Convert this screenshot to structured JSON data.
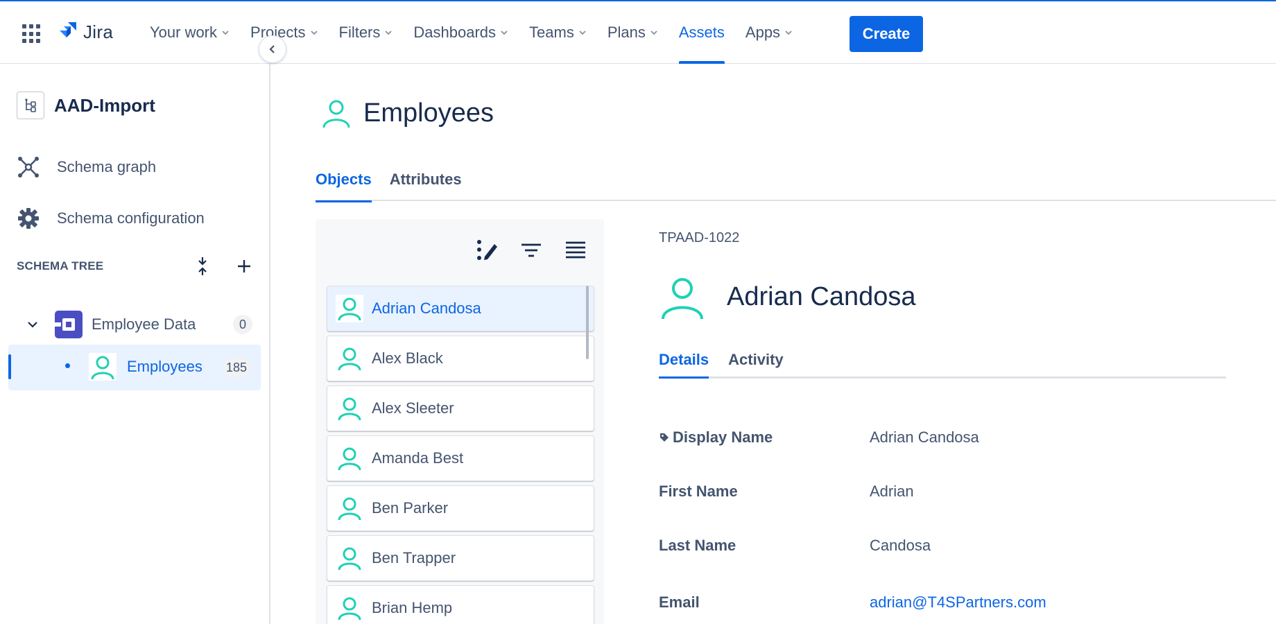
{
  "topnav": {
    "logo_text": "Jira",
    "items": [
      {
        "label": "Your work",
        "dropdown": true
      },
      {
        "label": "Projects",
        "dropdown": true
      },
      {
        "label": "Filters",
        "dropdown": true
      },
      {
        "label": "Dashboards",
        "dropdown": true
      },
      {
        "label": "Teams",
        "dropdown": true
      },
      {
        "label": "Plans",
        "dropdown": true
      },
      {
        "label": "Assets",
        "dropdown": false,
        "active": true
      },
      {
        "label": "Apps",
        "dropdown": true
      }
    ],
    "create_label": "Create"
  },
  "sidebar": {
    "schema_title": "AAD-Import",
    "links": [
      {
        "label": "Schema graph",
        "icon": "schema-graph-icon"
      },
      {
        "label": "Schema configuration",
        "icon": "gear-icon"
      }
    ],
    "tree_heading": "SCHEMA TREE",
    "tree": {
      "parent": {
        "label": "Employee Data",
        "count": "0"
      },
      "child": {
        "label": "Employees",
        "count": "185"
      }
    }
  },
  "main": {
    "title": "Employees",
    "tabs": [
      "Objects",
      "Attributes"
    ],
    "active_tab": "Objects",
    "objects": [
      "Adrian Candosa",
      "Alex Black",
      "Alex Sleeter",
      "Amanda Best",
      "Ben Parker",
      "Ben Trapper",
      "Brian Hemp"
    ],
    "selected_object": "Adrian Candosa"
  },
  "detail": {
    "key": "TPAAD-1022",
    "name": "Adrian Candosa",
    "tabs": [
      "Details",
      "Activity"
    ],
    "attributes": [
      {
        "label": "Display Name",
        "value": "Adrian Candosa",
        "label_icon": "tag-icon"
      },
      {
        "label": "First Name",
        "value": "Adrian"
      },
      {
        "label": "Last Name",
        "value": "Candosa"
      },
      {
        "label": "Email",
        "value": "adrian@T4SPartners.com",
        "link": true
      }
    ]
  },
  "colors": {
    "accent": "#0c66e4",
    "avatar": "#1fd1b4",
    "schema_icon": "#4b4ec3"
  }
}
